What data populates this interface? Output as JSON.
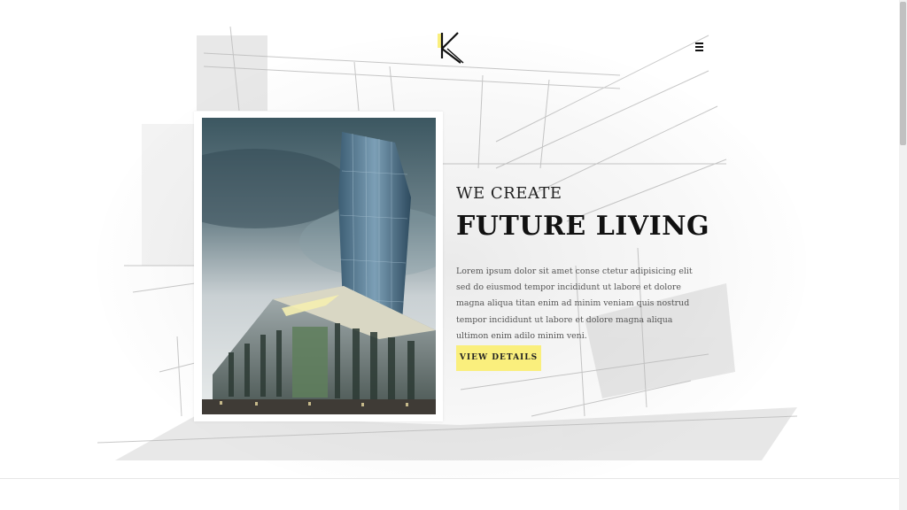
{
  "header": {
    "logo_letter": "K",
    "logo_accent_color": "#faef7d",
    "menu_icon": "hamburger-icon"
  },
  "hero": {
    "eyebrow": "WE CREATE",
    "title": "FUTURE LIVING",
    "body": "Lorem ipsum dolor sit amet conse ctetur adipisicing elit sed do eiusmod tempor incididunt ut labore et dolore magna aliqua titan enim ad minim veniam quis nostrud tempor incididunt ut labore et dolore magna aliqua ultimon enim adilo minim veni.",
    "cta_label": "VIEW DETAILS",
    "cta_color": "#faef7d"
  },
  "media": {
    "image_subject": "skyscraper-building-photo"
  }
}
